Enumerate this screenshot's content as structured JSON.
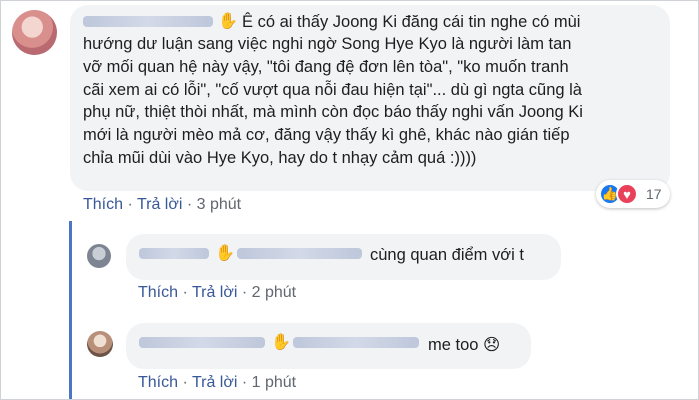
{
  "main_comment": {
    "author_obscured": true,
    "lines": [
      "Ê có ai thấy Joong Ki đăng cái tin nghe có mùi",
      "hướng dư luận sang việc nghi ngờ Song Hye Kyo là người làm tan",
      "vỡ mối quan hệ này vậy, \"tôi đang đệ đơn lên tòa\", \"ko muốn tranh",
      "cãi xem ai có lỗi\", \"cố vượt qua nỗi đau hiện tại\"... dù gì ngta cũng là",
      "phụ nữ, thiệt thòi nhất, mà mình còn đọc báo thấy nghi vấn Joong Ki",
      "mới là người mèo mả cơ, đăng vậy thấy kì ghê, khác nào gián tiếp",
      "chỉa mũi dùi vào Hye Kyo, hay do t nhạy cảm quá :))))"
    ],
    "actions": {
      "like": "Thích",
      "reply": "Trả lời",
      "time": "3 phút",
      "sep": "·"
    },
    "reactions": {
      "count": "17",
      "icons": [
        "like-icon",
        "love-icon"
      ]
    }
  },
  "replies": [
    {
      "author_obscured": true,
      "text": "cùng quan điểm với t",
      "actions": {
        "like": "Thích",
        "reply": "Trả lời",
        "time": "2 phút",
        "sep": "·"
      }
    },
    {
      "author_obscured": true,
      "text": "me too 😞",
      "actions": {
        "like": "Thích",
        "reply": "Trả lời",
        "time": "1 phút",
        "sep": "·"
      }
    }
  ],
  "colors": {
    "bubble": "#f2f3f5",
    "link": "#385898",
    "meta": "#606770",
    "thread_line": "#4a76c4",
    "like": "#1877f2",
    "love": "#e9415a"
  }
}
